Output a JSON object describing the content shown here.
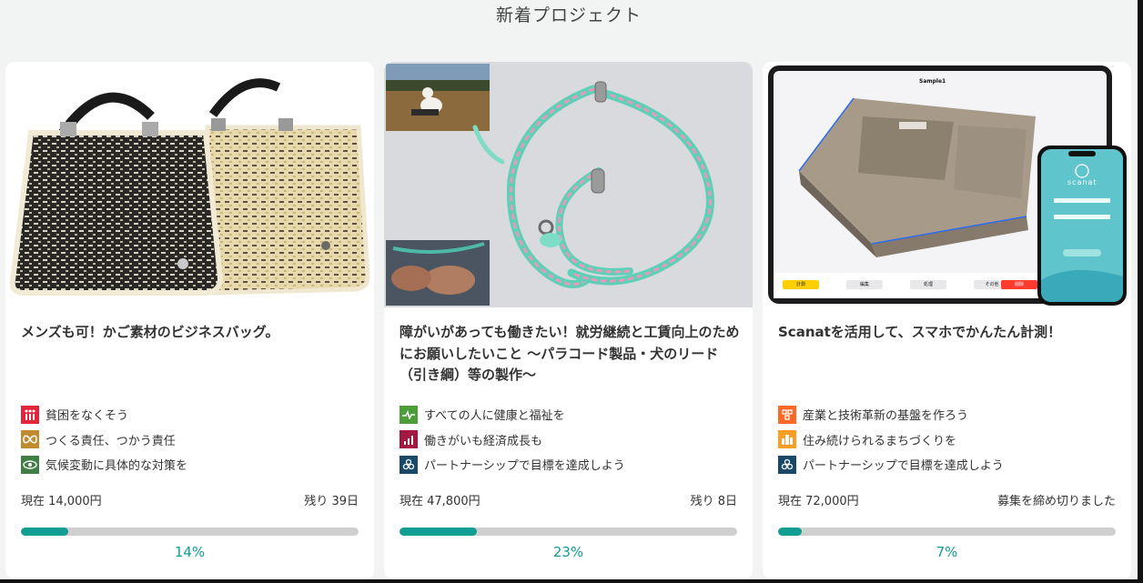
{
  "section_title": "新着プロジェクト",
  "projects": [
    {
      "title": "メンズも可！かご素材のビジネスバッグ。",
      "sdgs": [
        {
          "label": "貧困をなくそう",
          "icon": "sdg-1-no-poverty-icon",
          "color": "#e5243b"
        },
        {
          "label": "つくる責任、つかう責任",
          "icon": "sdg-12-responsible-consumption-icon",
          "color": "#bf8b2e"
        },
        {
          "label": "気候変動に具体的な対策を",
          "icon": "sdg-13-climate-action-icon",
          "color": "#3f7e44"
        }
      ],
      "amount": "現在 14,000円",
      "remaining": "残り 39日",
      "progress_percent": 14,
      "percent_label": "14%"
    },
    {
      "title": "障がいがあっても働きたい！就労継続と工賃向上のためにお願いしたいこと 〜パラコード製品・犬のリード（引き綱）等の製作〜",
      "sdgs": [
        {
          "label": "すべての人に健康と福祉を",
          "icon": "sdg-3-good-health-icon",
          "color": "#4c9f38"
        },
        {
          "label": "働きがいも経済成長も",
          "icon": "sdg-8-decent-work-icon",
          "color": "#a21942"
        },
        {
          "label": "パートナーシップで目標を達成しよう",
          "icon": "sdg-17-partnerships-icon",
          "color": "#19486a"
        }
      ],
      "amount": "現在 47,800円",
      "remaining": "残り 8日",
      "progress_percent": 23,
      "percent_label": "23%"
    },
    {
      "title": "Scanatを活用して、スマホでかんたん計測！",
      "sdgs": [
        {
          "label": "産業と技術革新の基盤を作ろう",
          "icon": "sdg-9-industry-innovation-icon",
          "color": "#fd6925"
        },
        {
          "label": "住み続けられるまちづくりを",
          "icon": "sdg-11-sustainable-cities-icon",
          "color": "#fd9d24"
        },
        {
          "label": "パートナーシップで目標を達成しよう",
          "icon": "sdg-17-partnerships-icon",
          "color": "#19486a"
        }
      ],
      "amount": "現在 72,000円",
      "remaining": "募集を締め切りました",
      "progress_percent": 7,
      "percent_label": "7%",
      "image_ui": {
        "model_name": "Sample1",
        "phone_brand": "scanat",
        "toolbar": [
          "計測",
          "編集",
          "処理",
          "その他",
          "削除"
        ]
      }
    }
  ]
}
